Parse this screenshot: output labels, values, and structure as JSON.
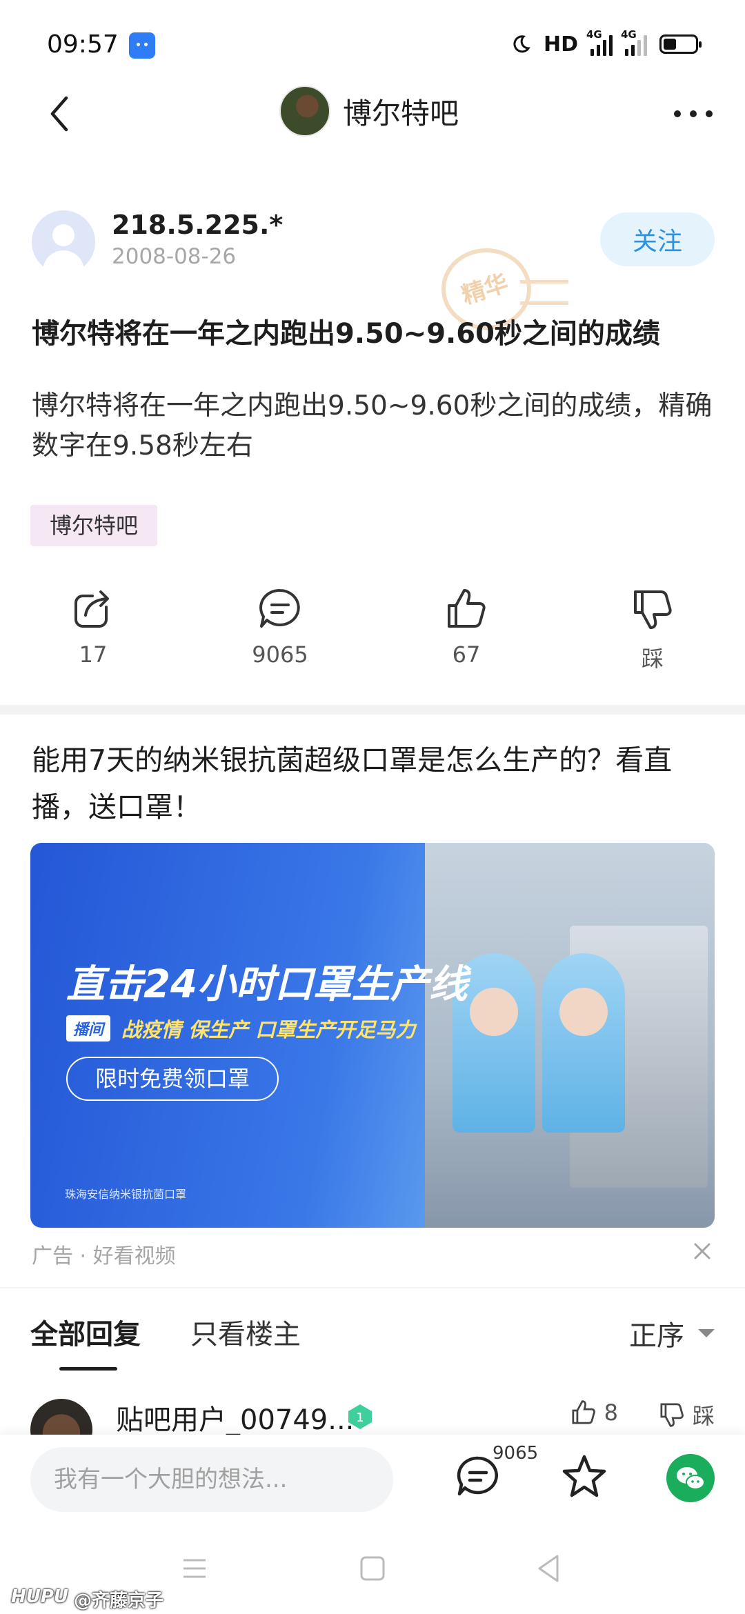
{
  "status_bar": {
    "time": "09:57",
    "network_label": "HD",
    "signal_1": "4G",
    "signal_2": "4G",
    "battery_level": 0.4
  },
  "nav": {
    "title": "博尔特吧"
  },
  "post": {
    "author": "218.5.225.*",
    "date": "2008-08-26",
    "follow_label": "关注",
    "stamp_text": "精华",
    "title": "博尔特将在一年之内跑出9.50~9.60秒之间的成绩",
    "body": "博尔特将在一年之内跑出9.50~9.60秒之间的成绩，精确数字在9.58秒左右",
    "tag": "博尔特吧",
    "actions": {
      "share_count": "17",
      "comment_count": "9065",
      "like_count": "67",
      "dislike_label": "踩"
    }
  },
  "ad": {
    "title": "能用7天的纳米银抗菌超级口罩是怎么生产的？看直播，送口罩！",
    "headline": "直击24小时口罩生产线",
    "live_tag": "播间",
    "subtext": "战疫情 保生产 口罩生产开足马力",
    "cta": "限时免费领口罩",
    "company": "珠海安信纳米银抗菌口罩",
    "meta": "广告 · 好看视频"
  },
  "replies": {
    "tab_all": "全部回复",
    "tab_owner": "只看楼主",
    "sort_label": "正序",
    "first": {
      "name": "贴吧用户_00749...",
      "like_count": "8",
      "dislike_label": "踩"
    }
  },
  "bottom_bar": {
    "input_placeholder": "我有一个大胆的想法...",
    "comment_count": "9065"
  },
  "watermark": {
    "brand": "HUPU",
    "user": "@齐藤京子"
  },
  "colors": {
    "accent_blue": "#2b91e3",
    "follow_bg": "#e4f3fc",
    "tag_bg": "#f5e7f4",
    "wechat_green": "#1aad5b"
  }
}
